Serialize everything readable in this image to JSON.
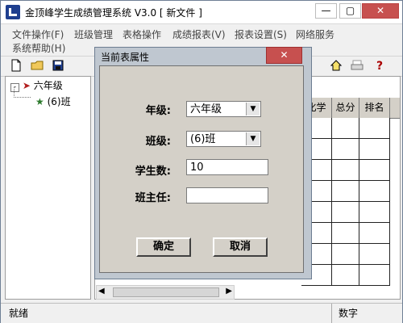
{
  "window": {
    "title": "金顶峰学生成绩管理系统 V3.0 [ 新文件 ]",
    "minimize_label": "—",
    "maximize_label": "▢",
    "close_label": "✕"
  },
  "menu": [
    "文件操作(F)",
    "班级管理",
    "表格操作",
    "成绩报表(V)",
    "报表设置(S)",
    "网络服务",
    "系统帮助(H)"
  ],
  "tree": {
    "root": "六年级",
    "child": "(6)班"
  },
  "grid": {
    "columns": [
      "化学",
      "总分",
      "排名"
    ]
  },
  "dialog": {
    "title": "当前表属性",
    "close_label": "✕",
    "grade_label": "年级:",
    "grade_value": "六年级",
    "class_label": "班级:",
    "class_value": "(6)班",
    "students_label": "学生数:",
    "students_value": "10",
    "teacher_label": "班主任:",
    "teacher_value": "",
    "ok_label": "确定",
    "cancel_label": "取消"
  },
  "status": {
    "left": "就绪",
    "right": "数字"
  },
  "icons": {
    "new": "new-file-icon",
    "open": "open-folder-icon",
    "save": "save-icon",
    "home": "home-icon",
    "print": "print-icon",
    "help": "help-icon",
    "scroll_left": "scroll-left-icon",
    "scroll_right": "scroll-right-icon"
  }
}
